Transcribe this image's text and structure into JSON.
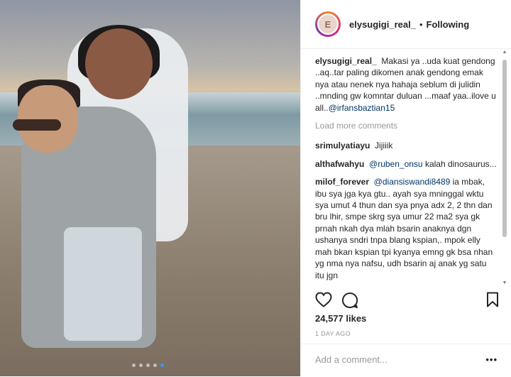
{
  "post": {
    "username": "elysugigi_real_",
    "separator": "•",
    "follow_status": "Following",
    "avatar_initial": "E",
    "caption": {
      "username": "elysugigi_real_",
      "text": "Makasi ya ..uda kuat gendong ..aq..tar paling dikomen anak gendong emak nya atau nenek nya hahaja seblum di julidin ..mnding gw komntar duluan ...maaf yaa..ilove u all..",
      "mention": "@irfansbaztian15"
    },
    "load_more": "Load more comments",
    "comments": [
      {
        "username": "srimulyatiayu",
        "pre": "",
        "mention": "",
        "text": "Jijiiik"
      },
      {
        "username": "althafwahyu",
        "pre": "",
        "mention": "@ruben_onsu",
        "text": " kalah dinosaurus..."
      },
      {
        "username": "milof_forever",
        "pre": "",
        "mention": "@diansiswandi8489",
        "text": " ia mbak, ibu sya jga kya gtu.. ayah sya mninggal wktu sya umut 4 thun dan sya pnya adx 2, 2 thn dan bru lhir, smpe skrg sya umur 22 ma2 sya gk prnah nkah dya mlah bsarin anaknya dgn ushanya sndri tnpa blang kspian,. mpok elly mah bkan kspian tpi kyanya emng gk bsa nhan yg nma nya nafsu, udh bsarin aj anak yg satu itu jgn"
      }
    ],
    "likes": "24,577 likes",
    "time": "1 DAY AGO",
    "add_comment_placeholder": "Add a comment...",
    "more_options": "•••",
    "carousel": {
      "count": 5,
      "active_index": 4
    }
  },
  "icons": {
    "like": "heart-icon",
    "comment": "comment-bubble-icon",
    "save": "bookmark-icon",
    "more": "more-options-icon"
  },
  "colors": {
    "mention": "#003569",
    "meta": "#999999",
    "active_dot": "#3897f0"
  }
}
